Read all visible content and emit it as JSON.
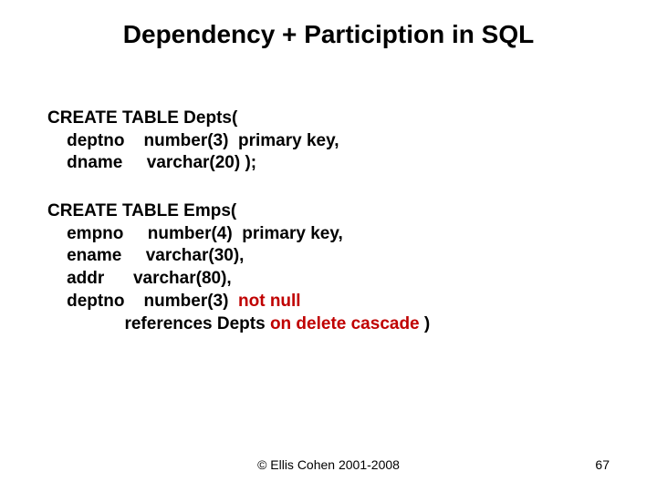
{
  "title": "Dependency + Particiption in SQL",
  "block1": {
    "l1": "CREATE TABLE Depts(",
    "l2": "    deptno    number(3)  primary key,",
    "l3": "    dname     varchar(20) );"
  },
  "block2": {
    "l1": "CREATE TABLE Emps(",
    "l2": "    empno     number(4)  primary key,",
    "l3": "    ename     varchar(30),",
    "l4": "    addr      varchar(80),",
    "l5a": "    deptno    number(3)  ",
    "l5b": "not null",
    "l6a": "                references Depts ",
    "l6b": "on delete cascade",
    "l6c": " )"
  },
  "copyright": "© Ellis Cohen 2001-2008",
  "pageNum": "67"
}
